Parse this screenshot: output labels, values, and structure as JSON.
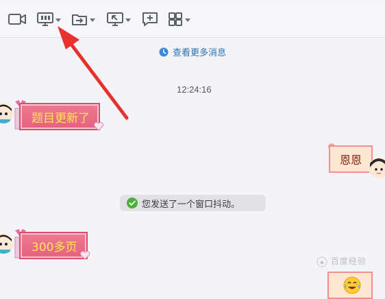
{
  "toolbar": {
    "buttons": [
      {
        "icon": "video-camera-icon",
        "has_dropdown": false
      },
      {
        "icon": "screen-share-icon",
        "has_dropdown": true
      },
      {
        "icon": "send-file-icon",
        "has_dropdown": true
      },
      {
        "icon": "remote-desktop-icon",
        "has_dropdown": true
      },
      {
        "icon": "add-chat-icon",
        "has_dropdown": false
      },
      {
        "icon": "apps-grid-icon",
        "has_dropdown": true
      }
    ]
  },
  "chat": {
    "view_more": "查看更多消息",
    "timestamp": "12:24:16",
    "messages": [
      {
        "from": "other",
        "text": "题目更新了",
        "style": "pink-gift"
      },
      {
        "from": "self",
        "text": "恩恩",
        "style": "peach"
      },
      {
        "from": "system",
        "text": "您发送了一个窗口抖动。"
      },
      {
        "from": "other",
        "text": "300多页",
        "style": "pink-gift"
      },
      {
        "from": "self",
        "text": "",
        "style": "peach",
        "emoji": "crying-laughing-emoji"
      }
    ]
  },
  "watermark": "百度经验",
  "colors": {
    "link_blue": "#2a71b8",
    "annotation_arrow": "#e8312c",
    "bubble_pink": "#e4617e",
    "bubble_text_yellow": "#ffe45c",
    "bubble_peach": "#fde6d2"
  }
}
